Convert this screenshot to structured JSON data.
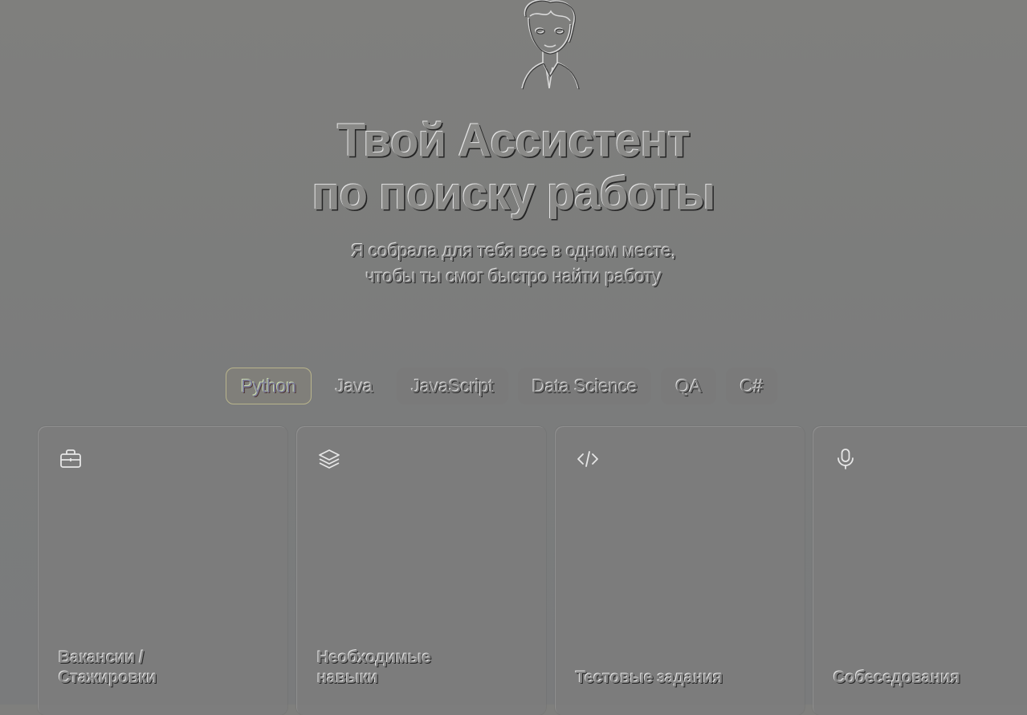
{
  "hero": {
    "title_line1": "Твой Ассистент",
    "title_line2": "по поиску работы",
    "subtitle_line1": "Я собрала для тебя все в одном месте,",
    "subtitle_line2": "чтобы ты смог быстро найти работу"
  },
  "tabs": [
    {
      "label": "Python",
      "active": true
    },
    {
      "label": "Java",
      "active": false
    },
    {
      "label": "JavaScript",
      "active": false
    },
    {
      "label": "Data Science",
      "active": false
    },
    {
      "label": "QA",
      "active": false
    },
    {
      "label": "C#",
      "active": false
    }
  ],
  "cards": [
    {
      "icon": "briefcase-icon",
      "label": "Вакансии /\nСтажировки"
    },
    {
      "icon": "layers-icon",
      "label": "Необходимые\nнавыки"
    },
    {
      "icon": "code-icon",
      "label": "Тестовые задания"
    },
    {
      "icon": "microphone-icon",
      "label": "Собеседования"
    }
  ],
  "colors": {
    "background": "#7c7c7c",
    "active_tab_border": "#b9b58c"
  }
}
